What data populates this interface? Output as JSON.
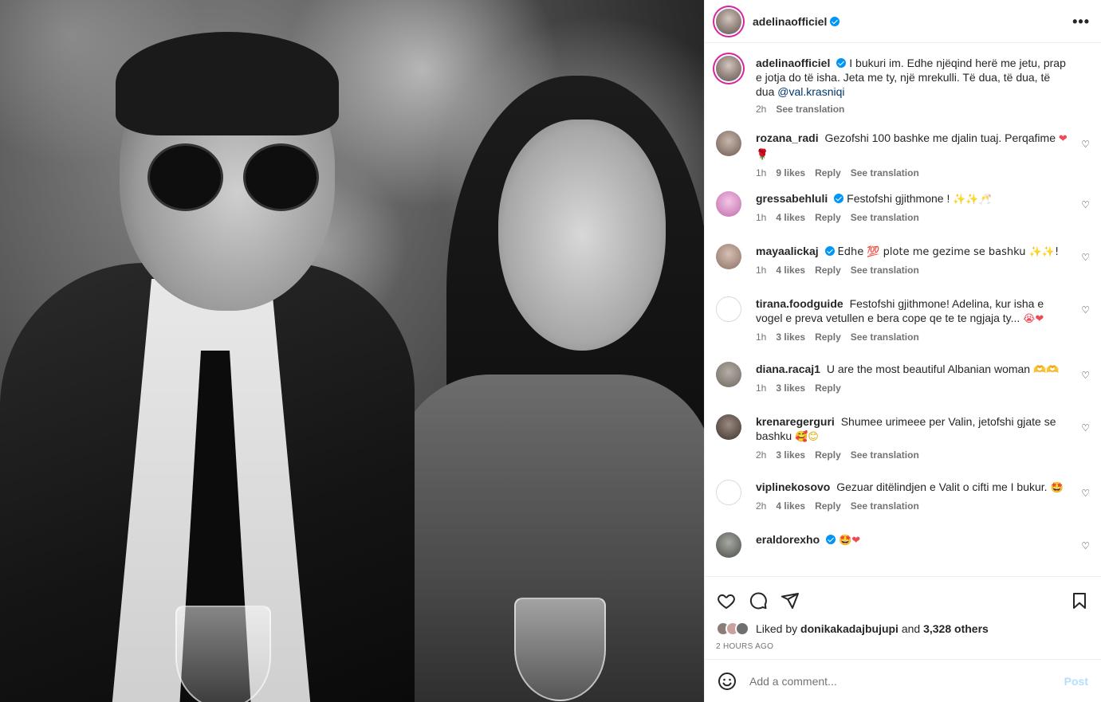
{
  "header": {
    "username": "adelinaofficiel",
    "more_label": "•••"
  },
  "caption": {
    "username": "adelinaofficiel",
    "text": "I bukuri im. Edhe njëqind herë me jetu, prap e jotja do të isha. Jeta me ty, një mrekulli. Të dua, të dua, të dua",
    "mention": "@val.krasniqi",
    "time": "2h",
    "see_translation": "See translation"
  },
  "comments": [
    {
      "username": "rozana_radi",
      "verified": false,
      "text": "Gezofshi 100 bashke me djalin tuaj. Perqafime",
      "emoji": "❤ 🌹",
      "time": "1h",
      "likes": "9 likes",
      "reply": "Reply",
      "translation": "See translation"
    },
    {
      "username": "gressabehluli",
      "verified": true,
      "text": "Festofshi gjithmone !",
      "emoji": "✨✨🥂",
      "time": "1h",
      "likes": "4 likes",
      "reply": "Reply",
      "translation": "See translation"
    },
    {
      "username": "mayaalickaj",
      "verified": true,
      "text": "Edhe 💯 plote me gezime se bashku ✨✨!",
      "emoji": "",
      "time": "1h",
      "likes": "4 likes",
      "reply": "Reply",
      "translation": "See translation"
    },
    {
      "username": "tirana.foodguide",
      "verified": false,
      "text": "Festofshi gjithmone! Adelina, kur isha e vogel e preva vetullen e bera cope qe te te ngjaja ty...",
      "emoji": "😭❤",
      "time": "1h",
      "likes": "3 likes",
      "reply": "Reply",
      "translation": "See translation"
    },
    {
      "username": "diana.racaj1",
      "verified": false,
      "text": "U are the most beautiful Albanian woman",
      "emoji": "🫶🫶",
      "time": "1h",
      "likes": "3 likes",
      "reply": "Reply",
      "translation": ""
    },
    {
      "username": "krenaregerguri",
      "verified": false,
      "text": "Shumee urimeee per Valin, jetofshi gjate se bashku",
      "emoji": "🥰😊",
      "time": "2h",
      "likes": "3 likes",
      "reply": "Reply",
      "translation": "See translation"
    },
    {
      "username": "viplinekosovo",
      "verified": false,
      "text": "Gezuar ditëlindjen e Valit o cifti me I bukur.",
      "emoji": "🤩",
      "time": "2h",
      "likes": "4 likes",
      "reply": "Reply",
      "translation": "See translation"
    },
    {
      "username": "eraldorexho",
      "verified": true,
      "text": "",
      "emoji": "🤩❤",
      "time": "",
      "likes": "",
      "reply": "",
      "translation": ""
    }
  ],
  "actions": {
    "liked_by_prefix": "Liked by",
    "liked_by_user": "donikakadajbujupi",
    "liked_by_and": "and",
    "liked_by_others": "3,328 others",
    "time_ago": "2 HOURS AGO"
  },
  "add_comment": {
    "placeholder": "Add a comment...",
    "post_label": "Post"
  },
  "colors": {
    "verified": "#0095f6",
    "heart": "#ed4956",
    "post_disabled": "#b2dffc",
    "mention": "#00376b"
  }
}
